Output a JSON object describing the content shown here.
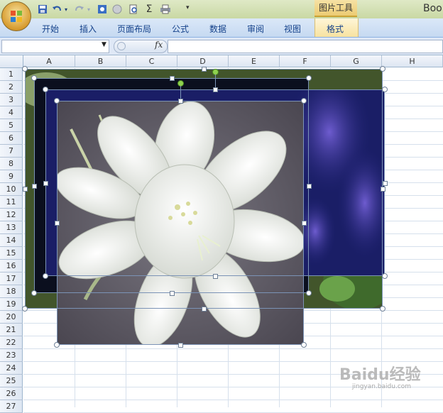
{
  "window": {
    "title_fragment": "Boo",
    "contextual_tab_group": "图片工具"
  },
  "quick_access": {
    "icons": [
      "save-icon",
      "undo-icon",
      "redo-icon",
      "picture-icon",
      "circle-icon",
      "print-preview-icon",
      "sum-icon",
      "print-icon"
    ],
    "sum_glyph": "Σ",
    "more": "▾"
  },
  "ribbon": {
    "tabs": [
      "开始",
      "插入",
      "页面布局",
      "公式",
      "数据",
      "审阅",
      "视图",
      "格式"
    ]
  },
  "formula_bar": {
    "name_box": "",
    "fx": "fx",
    "formula": ""
  },
  "sheet": {
    "columns": [
      "A",
      "B",
      "C",
      "D",
      "E",
      "F",
      "G",
      "H"
    ],
    "rows": [
      "1",
      "2",
      "3",
      "4",
      "5",
      "6",
      "7",
      "8",
      "9",
      "10",
      "11",
      "12",
      "13",
      "14",
      "15",
      "16",
      "17",
      "18",
      "19",
      "20",
      "21",
      "22",
      "23",
      "24",
      "25",
      "26",
      "27"
    ]
  },
  "pictures": [
    {
      "name": "garden-flower-photo",
      "selected": true
    },
    {
      "name": "dark-night-photo",
      "selected": true
    },
    {
      "name": "blue-lupine-photo",
      "selected": true
    },
    {
      "name": "white-flower-photo",
      "selected": true
    }
  ],
  "watermark": {
    "text": "Baidu经验",
    "url": "jingyan.baidu.com"
  },
  "colors": {
    "ribbon_blue": "#c5d9f1",
    "tools_tab": "#eccc73",
    "handle_green": "#8fd14f"
  }
}
